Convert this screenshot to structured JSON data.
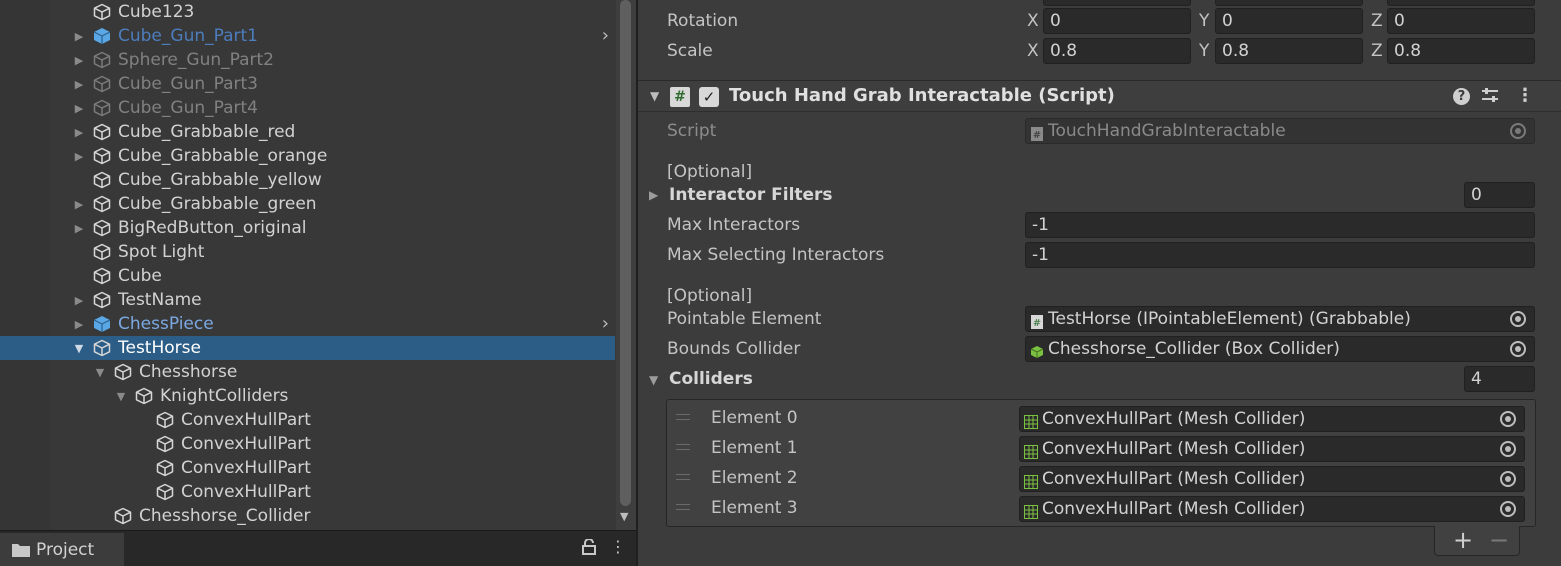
{
  "hierarchy": {
    "items": [
      {
        "label": "Cube123",
        "style": "normal",
        "arrow": "",
        "prefab": false
      },
      {
        "label": "Cube_Gun_Part1",
        "style": "prefab-on",
        "arrow": "right",
        "prefab": true,
        "chevron": "›"
      },
      {
        "label": "Sphere_Gun_Part2",
        "style": "dim",
        "arrow": "right",
        "prefab": false
      },
      {
        "label": "Cube_Gun_Part3",
        "style": "dim",
        "arrow": "right",
        "prefab": false
      },
      {
        "label": "Cube_Gun_Part4",
        "style": "dim",
        "arrow": "right",
        "prefab": false
      },
      {
        "label": "Cube_Grabbable_red",
        "style": "normal",
        "arrow": "right",
        "prefab": false
      },
      {
        "label": "Cube_Grabbable_orange",
        "style": "normal",
        "arrow": "right",
        "prefab": false
      },
      {
        "label": "Cube_Grabbable_yellow",
        "style": "normal",
        "arrow": "",
        "prefab": false
      },
      {
        "label": "Cube_Grabbable_green",
        "style": "normal",
        "arrow": "right",
        "prefab": false
      },
      {
        "label": "BigRedButton_original",
        "style": "normal",
        "arrow": "right",
        "prefab": false
      },
      {
        "label": "Spot Light",
        "style": "normal",
        "arrow": "",
        "prefab": false
      },
      {
        "label": "Cube",
        "style": "normal",
        "arrow": "",
        "prefab": false
      },
      {
        "label": "TestName",
        "style": "normal",
        "arrow": "right",
        "prefab": false
      },
      {
        "label": "ChessPiece",
        "style": "prefab",
        "arrow": "right",
        "prefab": true,
        "chevron": "›"
      },
      {
        "label": "TestHorse",
        "style": "white",
        "arrow": "down",
        "prefab": false,
        "selected": true
      },
      {
        "label": "Chesshorse",
        "style": "normal",
        "arrow": "down",
        "prefab": false
      },
      {
        "label": "KnightColliders",
        "style": "normal",
        "arrow": "down",
        "prefab": false
      },
      {
        "label": "ConvexHullPart",
        "style": "normal",
        "arrow": "",
        "prefab": false
      },
      {
        "label": "ConvexHullPart",
        "style": "normal",
        "arrow": "",
        "prefab": false
      },
      {
        "label": "ConvexHullPart",
        "style": "normal",
        "arrow": "",
        "prefab": false
      },
      {
        "label": "ConvexHullPart",
        "style": "normal",
        "arrow": "",
        "prefab": false
      },
      {
        "label": "Chesshorse_Collider",
        "style": "normal",
        "arrow": "",
        "prefab": false
      }
    ]
  },
  "project": {
    "tab_label": "Project",
    "tab_icon": "folder-icon",
    "lock_icon": "lock-icon",
    "menu_icon": "kebab-menu-icon"
  },
  "transform": {
    "rotation_label": "Rotation",
    "scale_label": "Scale",
    "axis_x": "X",
    "axis_y": "Y",
    "axis_z": "Z",
    "rotation": {
      "x": "0",
      "y": "0",
      "z": "0"
    },
    "scale": {
      "x": "0.8",
      "y": "0.8",
      "z": "0.8"
    }
  },
  "component": {
    "title": "Touch Hand Grab Interactable (Script)",
    "icon": "script-hash-icon",
    "checkbox": "✓",
    "enabled": true,
    "help_icon": "?",
    "script_label": "Script",
    "script_value": "TouchHandGrabInteractable",
    "optional_header_1": "[Optional]",
    "interactor_filters_label": "Interactor Filters",
    "interactor_filters_count": "0",
    "max_interactors_label": "Max Interactors",
    "max_interactors_value": "-1",
    "max_selecting_label": "Max Selecting Interactors",
    "max_selecting_value": "-1",
    "optional_header_2": "[Optional]",
    "pointable_label": "Pointable Element",
    "pointable_value": "TestHorse (IPointableElement) (Grabbable)",
    "bounds_label": "Bounds Collider",
    "bounds_value": "Chesshorse_Collider (Box Collider)",
    "colliders_label": "Colliders",
    "colliders_count": "4",
    "colliders": [
      {
        "label": "Element 0",
        "value": "ConvexHullPart (Mesh Collider)"
      },
      {
        "label": "Element 1",
        "value": "ConvexHullPart (Mesh Collider)"
      },
      {
        "label": "Element 2",
        "value": "ConvexHullPart (Mesh Collider)"
      },
      {
        "label": "Element 3",
        "value": "ConvexHullPart (Mesh Collider)"
      }
    ],
    "add_label": "+",
    "remove_label": "−"
  },
  "colors": {
    "selection": "#2c5d87",
    "prefab_text": "#7ba8e2",
    "prefab_cube": "#5aa7e6",
    "collider_green": "#7cc242"
  }
}
